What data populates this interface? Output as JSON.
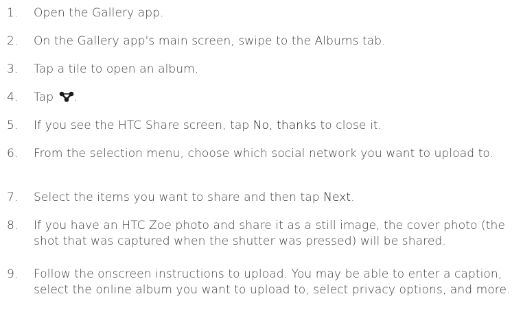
{
  "steps": [
    {
      "number": "1.",
      "text": "Open the Gallery app."
    },
    {
      "number": "2.",
      "text": "On the Gallery app's main screen, swipe to the Albums tab."
    },
    {
      "number": "3.",
      "text": "Tap a tile to open an album."
    },
    {
      "number": "4.",
      "text_before": "Tap ",
      "text_after": ".",
      "icon": "share-icon"
    },
    {
      "number": "5.",
      "text_before": "If you see the HTC Share screen, tap ",
      "bold": "No, thanks",
      "text_after": " to close it."
    },
    {
      "number": "6.",
      "text": "From the selection menu, choose which social network you want to upload to."
    },
    {
      "number": "7.",
      "text_before": "Select the items you want to share and then tap ",
      "bold": "Next",
      "text_after": "."
    },
    {
      "number": "8.",
      "text": "If you have an HTC Zoe photo and share it as a still image, the cover photo (the shot that was captured when the shutter was pressed) will be shared."
    },
    {
      "number": "9.",
      "text": "Follow the onscreen instructions to upload. You may be able to enter a caption, select the online album you want to upload to, select privacy options, and more."
    }
  ]
}
